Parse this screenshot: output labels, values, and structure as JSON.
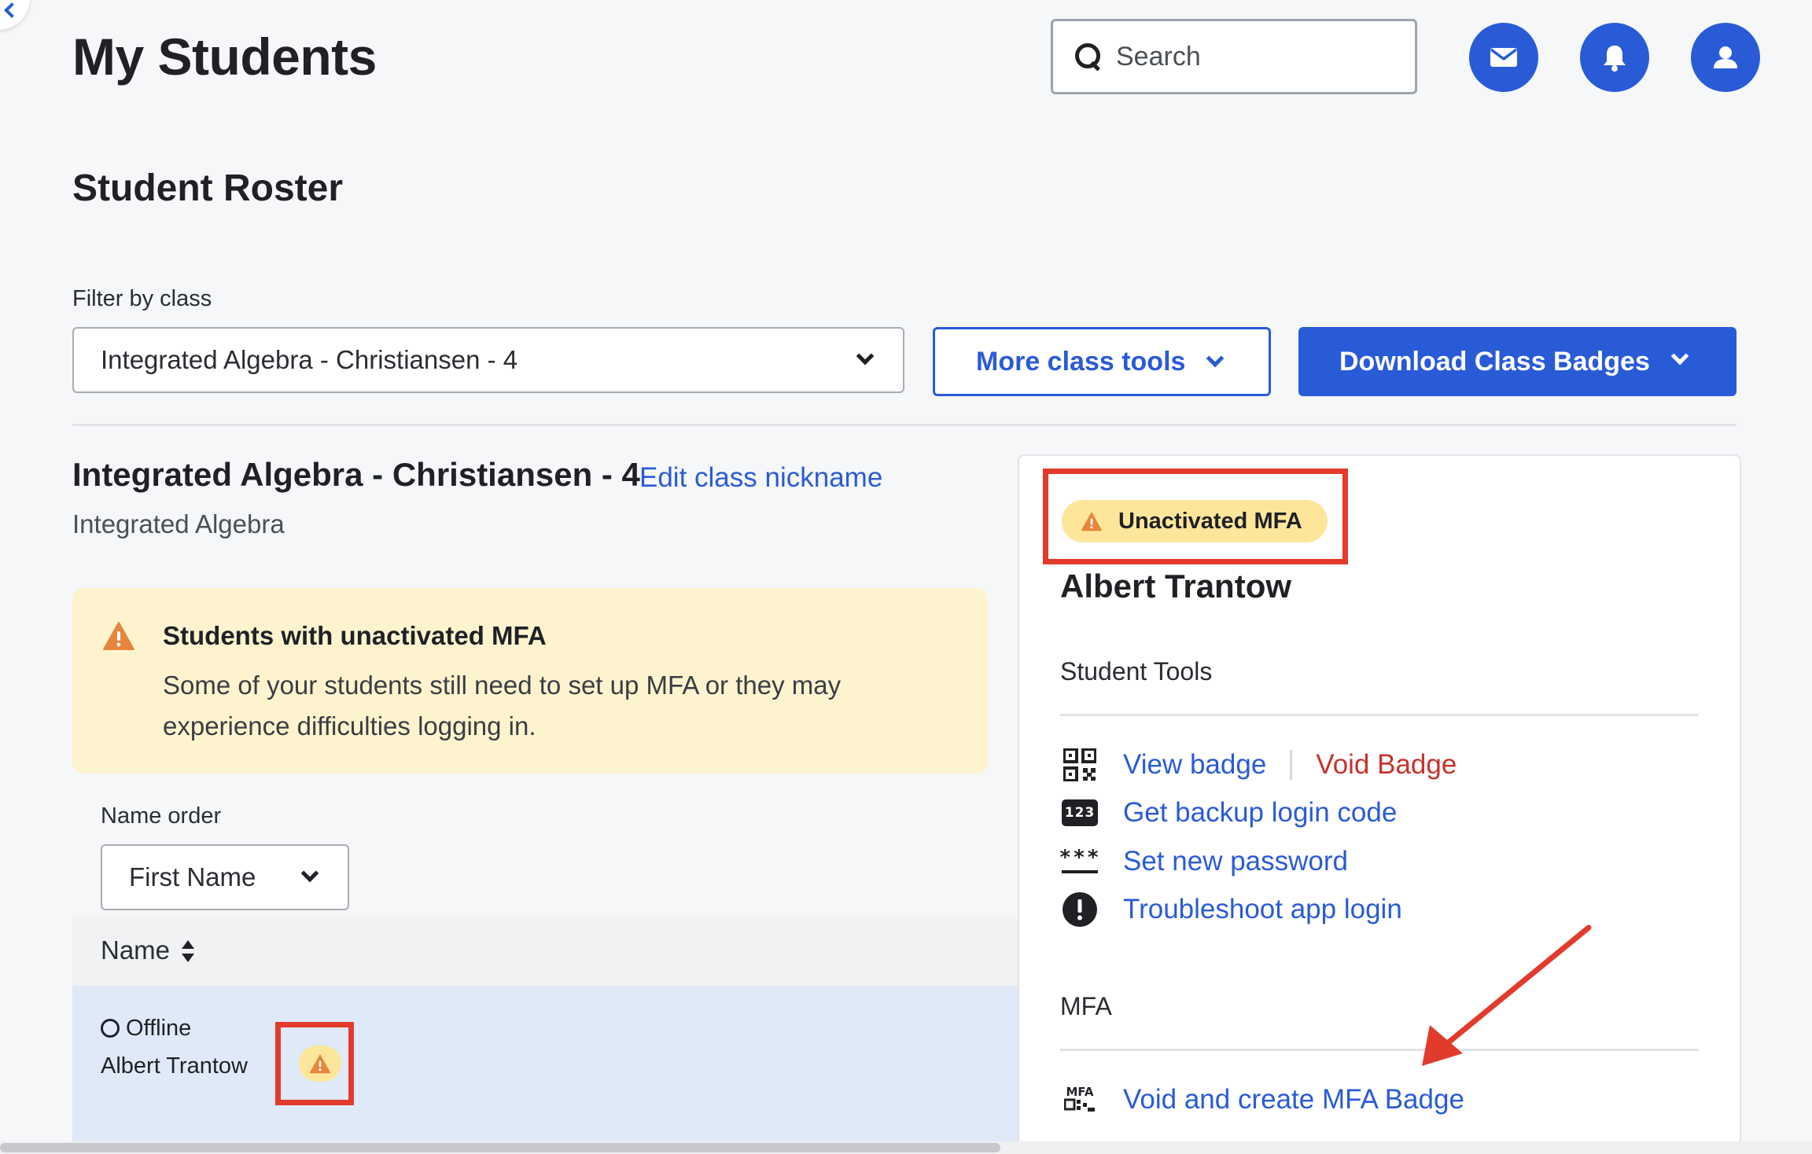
{
  "header": {
    "title": "My Students",
    "search": {
      "placeholder": "Search",
      "value": ""
    },
    "icons": [
      "mail-icon",
      "bell-icon",
      "user-icon"
    ]
  },
  "roster": {
    "title": "Student Roster",
    "filter_label": "Filter by class",
    "selected_class": "Integrated Algebra - Christiansen - 4",
    "more_tools_label": "More class tools",
    "download_label": "Download Class Badges"
  },
  "class_info": {
    "name": "Integrated Algebra - Christiansen - 4",
    "edit_label": "Edit class nickname",
    "subject": "Integrated Algebra"
  },
  "alert": {
    "title": "Students with unactivated MFA",
    "body": "Some of your students still need to set up MFA or they may experience difficulties logging in."
  },
  "name_order": {
    "label": "Name order",
    "selected": "First Name"
  },
  "table": {
    "column_name": "Name",
    "rows": [
      {
        "status": "Offline",
        "name": "Albert Trantow"
      }
    ]
  },
  "detail": {
    "badge": "Unactivated MFA",
    "name": "Albert Trantow",
    "tools_title": "Student Tools",
    "tools": {
      "view_badge": "View badge",
      "void_badge": "Void Badge",
      "backup_code": "Get backup login code",
      "backup_icon_text": "123",
      "set_password": "Set new password",
      "password_icon_text": "***",
      "troubleshoot": "Troubleshoot app login"
    },
    "mfa_title": "MFA",
    "mfa_icon_text": "MFA",
    "mfa_action": "Void and create MFA Badge"
  },
  "colors": {
    "accent": "#2a5bd7",
    "danger": "#c7332b",
    "warning_bg": "#fdf4cf",
    "warning_icon": "#e8853c",
    "annotation": "#e23b2c"
  }
}
